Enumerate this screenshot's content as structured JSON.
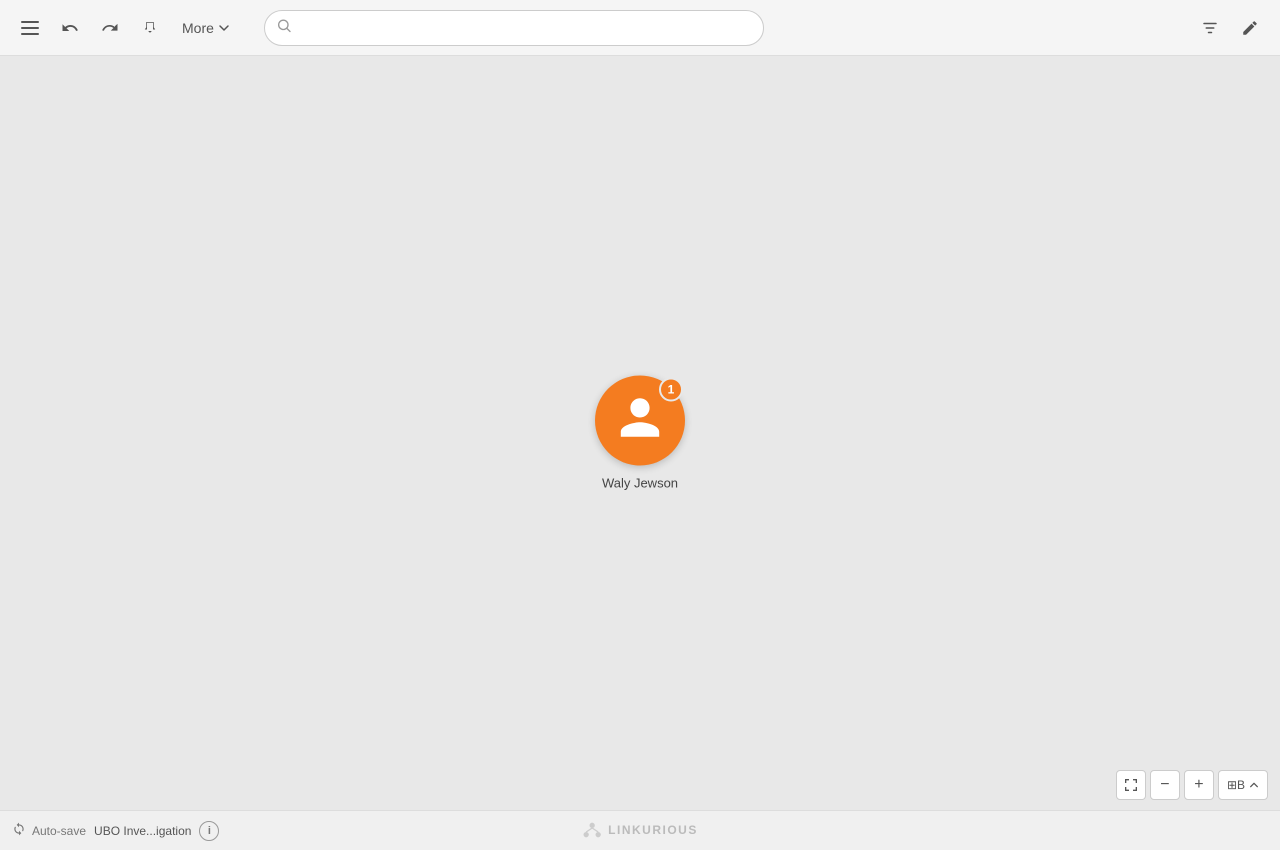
{
  "toolbar": {
    "more_label": "More",
    "search_placeholder": "",
    "filter_icon": "filter-icon",
    "edit_icon": "edit-icon"
  },
  "node": {
    "badge_count": "1",
    "label": "Waly Jewson"
  },
  "bottom_bar": {
    "autosave_label": "Auto-save",
    "investigation_label": "UBO Inve...igation",
    "info_label": "i"
  },
  "logo": {
    "text": "LINKURIOUS"
  },
  "zoom": {
    "minus_label": "−",
    "plus_label": "+",
    "layout_label": "⊞B",
    "fit_label": "⤢"
  }
}
